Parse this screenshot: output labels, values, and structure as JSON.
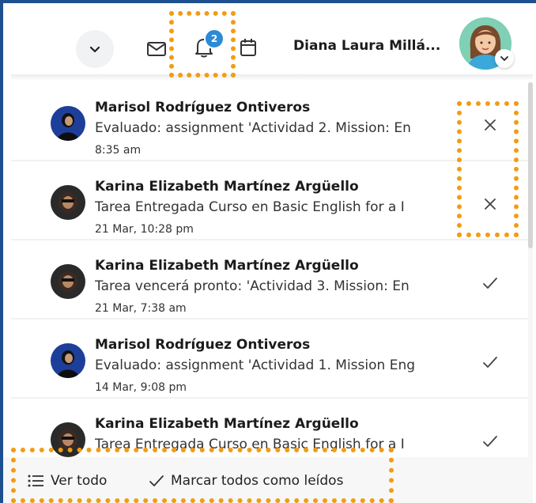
{
  "header": {
    "user_name": "Diana Laura Millá...",
    "notification_count": "2",
    "icons": [
      "chevron-down-icon",
      "mail-icon",
      "bell-icon",
      "calendar-icon",
      "avatar"
    ]
  },
  "notifications": [
    {
      "sender": "Marisol Rodríguez Ontiveros",
      "text": "Evaluado: assignment 'Actividad 2. Mission: En",
      "time": "8:35 am",
      "action": "dismiss"
    },
    {
      "sender": "Karina Elizabeth Martínez Argüello",
      "text": "Tarea Entregada Curso en Basic English for a I",
      "time": "21 Mar, 10:28 pm",
      "action": "dismiss"
    },
    {
      "sender": "Karina Elizabeth Martínez Argüello",
      "text": "Tarea vencerá pronto: 'Actividad 3. Mission: En",
      "time": "21 Mar, 7:38 am",
      "action": "read"
    },
    {
      "sender": "Marisol Rodríguez Ontiveros",
      "text": "Evaluado: assignment 'Actividad 1. Mission Eng",
      "time": "14 Mar, 9:08 pm",
      "action": "read"
    },
    {
      "sender": "Karina Elizabeth Martínez Argüello",
      "text": "Tarea Entregada Curso en Basic English for a I",
      "time": "",
      "action": "read"
    }
  ],
  "footer": {
    "view_all": "Ver todo",
    "mark_all_read": "Marcar todos como leídos"
  },
  "colors": {
    "frame": "#1e4f8f",
    "badge": "#2c8ad6",
    "highlight": "#f39c12"
  }
}
